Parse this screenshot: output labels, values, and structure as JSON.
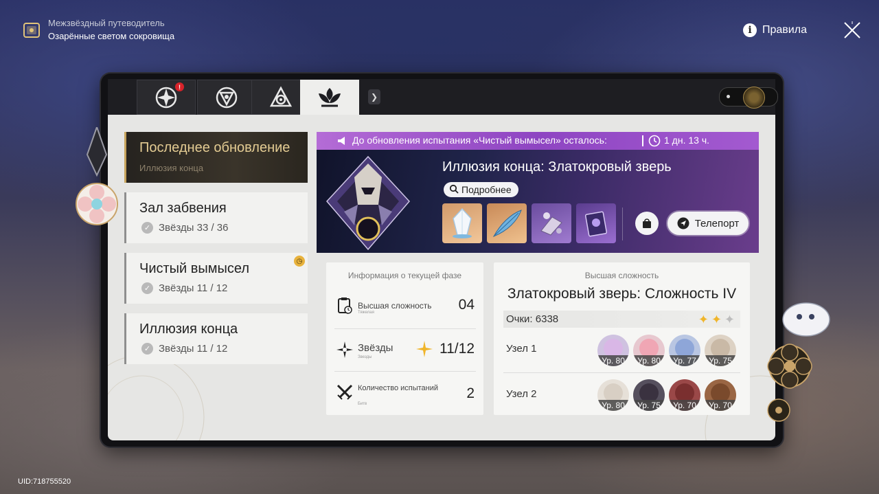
{
  "header": {
    "guide_title": "Межзвёздный путеводитель",
    "guide_subtitle": "Озарённые светом сокровища",
    "rules_label": "Правила",
    "guide_icon": "guidebook-icon",
    "close_icon": "close-icon"
  },
  "tabs": [
    {
      "icon": "tab-emblem-1-icon",
      "active": false,
      "badge": "!"
    },
    {
      "icon": "tab-emblem-2-icon",
      "active": false
    },
    {
      "icon": "tab-emblem-3-icon",
      "active": false
    },
    {
      "icon": "tab-emblem-4-icon",
      "active": true
    }
  ],
  "sidebar": {
    "items": [
      {
        "title": "Последнее обновление",
        "subtitle": "Иллюзия конца",
        "active": true
      },
      {
        "title": "Зал забвения",
        "stars": "Звёзды 33 / 36"
      },
      {
        "title": "Чистый вымысел",
        "stars": "Звёзды 11 / 12",
        "timer_badge": true
      },
      {
        "title": "Иллюзия конца",
        "stars": "Звёзды 11 / 12"
      }
    ]
  },
  "banner": {
    "notice": "До обновления испытания «Чистый вымысел» осталось:",
    "time_left": "1 дн. 13 ч.",
    "boss_title": "Иллюзия конца: Златокровый зверь",
    "details_label": "Подробнее",
    "teleport_label": "Телепорт",
    "rewards": [
      "crystal-reward-icon",
      "feather-reward-icon",
      "material-reward-icon",
      "book-reward-icon"
    ],
    "colors": {
      "notice": "#a35ad0",
      "accent": "#c7a45c"
    }
  },
  "phase_info": {
    "header": "Информация о текущей фазе",
    "rows": [
      {
        "label": "Высшая сложность",
        "tiny": "Тяжелая",
        "value": "04"
      },
      {
        "label": "Звёзды",
        "tiny": "Звезды",
        "value": "11/12"
      },
      {
        "label": "Количество испытаний",
        "tiny": "Битв",
        "value": "2"
      }
    ]
  },
  "top_difficulty": {
    "header": "Высшая сложность",
    "title": "Златокровый зверь: Сложность IV",
    "score": "Очки: 6338",
    "stars_earned": 2,
    "stars_total": 3,
    "nodes": [
      {
        "label": "Узел 1",
        "team": [
          {
            "lvl": "Ур. 80",
            "color": "#d9b7e6"
          },
          {
            "lvl": "Ур. 80",
            "color": "#f0a6b4"
          },
          {
            "lvl": "Ур. 77",
            "color": "#8ea6d8"
          },
          {
            "lvl": "Ур. 75",
            "color": "#c9b9a6"
          }
        ]
      },
      {
        "label": "Узел 2",
        "team": [
          {
            "lvl": "Ур. 80",
            "color": "#d8cfc4"
          },
          {
            "lvl": "Ур. 75",
            "color": "#3a3240"
          },
          {
            "lvl": "Ур. 70",
            "color": "#7a2f2f"
          },
          {
            "lvl": "Ур. 70",
            "color": "#7a4a2c"
          }
        ]
      }
    ]
  },
  "uid": "UID:718755520"
}
